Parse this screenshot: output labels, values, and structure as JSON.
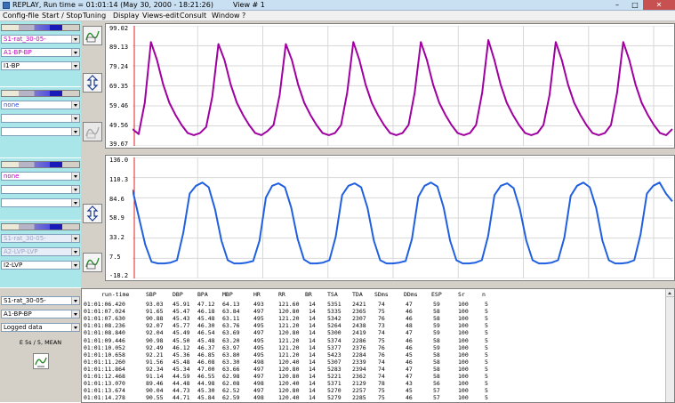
{
  "titlebar": {
    "title": "REPLAY,  Run time = 01:01:14  (May 30, 2000 - 18:21:26)",
    "view": "View # 1",
    "minimize": "–",
    "maximize": "□",
    "close": "✕"
  },
  "menu": [
    "Config-file",
    "Start / Stop",
    "Tuning",
    "Display",
    "Views-edit",
    "Consult",
    "Window",
    "?"
  ],
  "left": {
    "g1": {
      "combo1": "S1-rat_30-05-",
      "combo2": "A1-BP-BP",
      "combo3": "I1-BP"
    },
    "g2": {
      "combo1": "none",
      "combo2": "",
      "combo3": ""
    },
    "g3": {
      "combo1": "none",
      "combo2": "",
      "combo3": ""
    },
    "g4": {
      "combo1": "S1-rat_30-05-",
      "combo2": "A2-LVP-LVP",
      "combo3": "I2-LVP"
    },
    "g5": {
      "combo1": "S1-rat_30-05-",
      "combo2": "A1-BP-BP",
      "combo3": "Logged data",
      "label": "E 5s / 5, MEAN"
    }
  },
  "chart1": {
    "yticks": [
      "99.02",
      "89.13",
      "79.24",
      "69.35",
      "59.46",
      "49.56",
      "39.67"
    ],
    "color": "#a000a0"
  },
  "chart2": {
    "yticks": [
      "136.0",
      "110.3",
      "84.6",
      "58.9",
      "33.2",
      "7.5",
      "-18.2"
    ],
    "color": "#2060e0"
  },
  "chart_data": [
    {
      "type": "line",
      "ylim": [
        39.67,
        99.02
      ],
      "series": [
        {
          "values": [
            48,
            45.5,
            61,
            91,
            82,
            70,
            61,
            55,
            50,
            46,
            45,
            46,
            49,
            64,
            90,
            82,
            70,
            61,
            55,
            50,
            46,
            45,
            47,
            50,
            65,
            90,
            82,
            70,
            61,
            55,
            50,
            46,
            45,
            46,
            50,
            66,
            91,
            82,
            70,
            61,
            55,
            50,
            46,
            45,
            46,
            50,
            66,
            91,
            82,
            70,
            61,
            55,
            50,
            46,
            45,
            46,
            50,
            66,
            92,
            82,
            70,
            61,
            55,
            50,
            46,
            45,
            46,
            50,
            65,
            91,
            82,
            70,
            61,
            55,
            50,
            46,
            45,
            46,
            50,
            66,
            91,
            82,
            70,
            61,
            55,
            50,
            46,
            45,
            48
          ]
        }
      ]
    },
    {
      "type": "line",
      "ylim": [
        -18.2,
        136.0
      ],
      "series": [
        {
          "values": [
            95,
            60,
            25,
            3,
            1,
            1,
            2,
            5,
            40,
            90,
            100,
            104,
            98,
            70,
            30,
            5,
            1,
            1,
            2,
            4,
            30,
            85,
            100,
            103,
            98,
            72,
            32,
            6,
            1,
            1,
            2,
            5,
            35,
            88,
            100,
            103,
            98,
            72,
            30,
            5,
            1,
            1,
            2,
            4,
            32,
            86,
            100,
            104,
            99,
            72,
            30,
            5,
            1,
            1,
            2,
            5,
            36,
            88,
            100,
            103,
            97,
            70,
            30,
            5,
            1,
            1,
            2,
            5,
            34,
            87,
            100,
            104,
            98,
            72,
            30,
            5,
            1,
            1,
            2,
            5,
            38,
            90,
            100,
            104,
            90,
            80
          ]
        }
      ]
    }
  ],
  "table": {
    "headers": [
      "run-time",
      "SBP",
      "DBP",
      "BPA",
      "MBP",
      "HR",
      "RR",
      "BR",
      "TSA",
      "TDA",
      "SDms",
      "DDms",
      "ESP",
      "Sr",
      "n"
    ],
    "rows": [
      [
        "01:01:06.420",
        "93.03",
        "45.91",
        "47.12",
        "64.13",
        "493",
        "121.60",
        "14",
        "5351",
        "2421",
        "74",
        "47",
        "59",
        "100",
        "5"
      ],
      [
        "01:01:07.024",
        "91.65",
        "45.47",
        "46.18",
        "63.84",
        "497",
        "120.80",
        "14",
        "5335",
        "2365",
        "75",
        "46",
        "58",
        "100",
        "5"
      ],
      [
        "01:01:07.630",
        "90.88",
        "45.43",
        "45.48",
        "63.11",
        "495",
        "121.20",
        "14",
        "5342",
        "2307",
        "76",
        "46",
        "58",
        "100",
        "5"
      ],
      [
        "01:01:08.236",
        "92.07",
        "45.77",
        "46.30",
        "63.76",
        "495",
        "121.20",
        "14",
        "5264",
        "2438",
        "73",
        "48",
        "59",
        "100",
        "5"
      ],
      [
        "01:01:08.840",
        "92.04",
        "45.49",
        "46.54",
        "63.69",
        "497",
        "120.80",
        "14",
        "5300",
        "2419",
        "74",
        "47",
        "59",
        "100",
        "5"
      ],
      [
        "01:01:09.446",
        "90.98",
        "45.50",
        "45.48",
        "63.20",
        "495",
        "121.20",
        "14",
        "5374",
        "2286",
        "75",
        "46",
        "58",
        "100",
        "5"
      ],
      [
        "01:01:10.052",
        "92.49",
        "46.12",
        "46.37",
        "63.97",
        "495",
        "121.20",
        "14",
        "5377",
        "2376",
        "76",
        "46",
        "59",
        "100",
        "5"
      ],
      [
        "01:01:10.658",
        "92.21",
        "45.36",
        "46.85",
        "63.80",
        "495",
        "121.20",
        "14",
        "5423",
        "2284",
        "76",
        "45",
        "58",
        "100",
        "5"
      ],
      [
        "01:01:11.260",
        "91.56",
        "45.48",
        "46.08",
        "63.30",
        "498",
        "120.40",
        "14",
        "5307",
        "2339",
        "74",
        "46",
        "58",
        "100",
        "5"
      ],
      [
        "01:01:11.864",
        "92.34",
        "45.34",
        "47.00",
        "63.66",
        "497",
        "120.80",
        "14",
        "5283",
        "2394",
        "74",
        "47",
        "58",
        "100",
        "5"
      ],
      [
        "01:01:12.468",
        "91.14",
        "44.59",
        "46.55",
        "62.98",
        "497",
        "120.80",
        "14",
        "5221",
        "2362",
        "74",
        "47",
        "58",
        "100",
        "5"
      ],
      [
        "01:01:13.070",
        "89.46",
        "44.48",
        "44.98",
        "62.08",
        "498",
        "120.40",
        "14",
        "5371",
        "2129",
        "78",
        "43",
        "56",
        "100",
        "5"
      ],
      [
        "01:01:13.674",
        "90.04",
        "44.73",
        "45.30",
        "62.52",
        "497",
        "120.80",
        "14",
        "5270",
        "2257",
        "75",
        "45",
        "57",
        "100",
        "5"
      ],
      [
        "01:01:14.278",
        "90.55",
        "44.71",
        "45.84",
        "62.59",
        "498",
        "120.40",
        "14",
        "5279",
        "2285",
        "75",
        "46",
        "57",
        "100",
        "5"
      ]
    ]
  }
}
